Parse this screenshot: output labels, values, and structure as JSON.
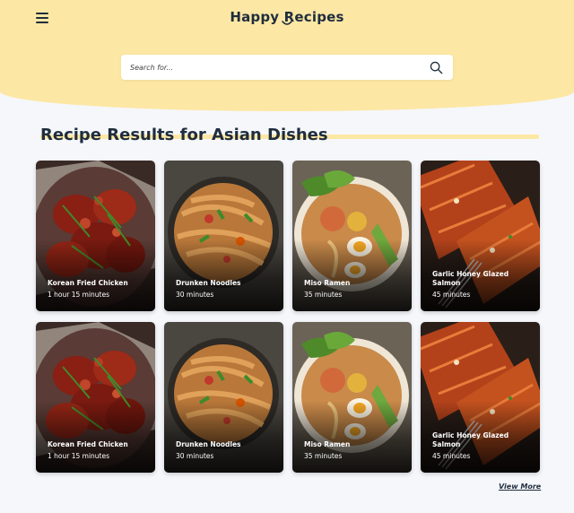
{
  "header": {
    "title": "Happy Recipes",
    "menu_icon": "hamburger-menu-icon",
    "accent_color": "#fde7a4"
  },
  "search": {
    "placeholder": "Search for...",
    "value": "",
    "icon": "search-icon"
  },
  "main": {
    "heading": "Recipe Results for Asian Dishes",
    "view_more_label": "View More",
    "recipes": [
      {
        "title": "Korean Fried Chicken",
        "time": "1 hour 15 minutes",
        "image": "korean-fried-chicken-photo"
      },
      {
        "title": "Drunken Noodles",
        "time": "30 minutes",
        "image": "drunken-noodles-photo"
      },
      {
        "title": "Miso Ramen",
        "time": "35 minutes",
        "image": "miso-ramen-photo"
      },
      {
        "title": "Garlic Honey Glazed Salmon",
        "time": "45 minutes",
        "image": "garlic-honey-salmon-photo"
      },
      {
        "title": "Korean Fried Chicken",
        "time": "1 hour 15 minutes",
        "image": "korean-fried-chicken-photo"
      },
      {
        "title": "Drunken Noodles",
        "time": "30 minutes",
        "image": "drunken-noodles-photo"
      },
      {
        "title": "Miso Ramen",
        "time": "35 minutes",
        "image": "miso-ramen-photo"
      },
      {
        "title": "Garlic Honey Glazed Salmon",
        "time": "45 minutes",
        "image": "garlic-honey-salmon-photo"
      }
    ]
  }
}
